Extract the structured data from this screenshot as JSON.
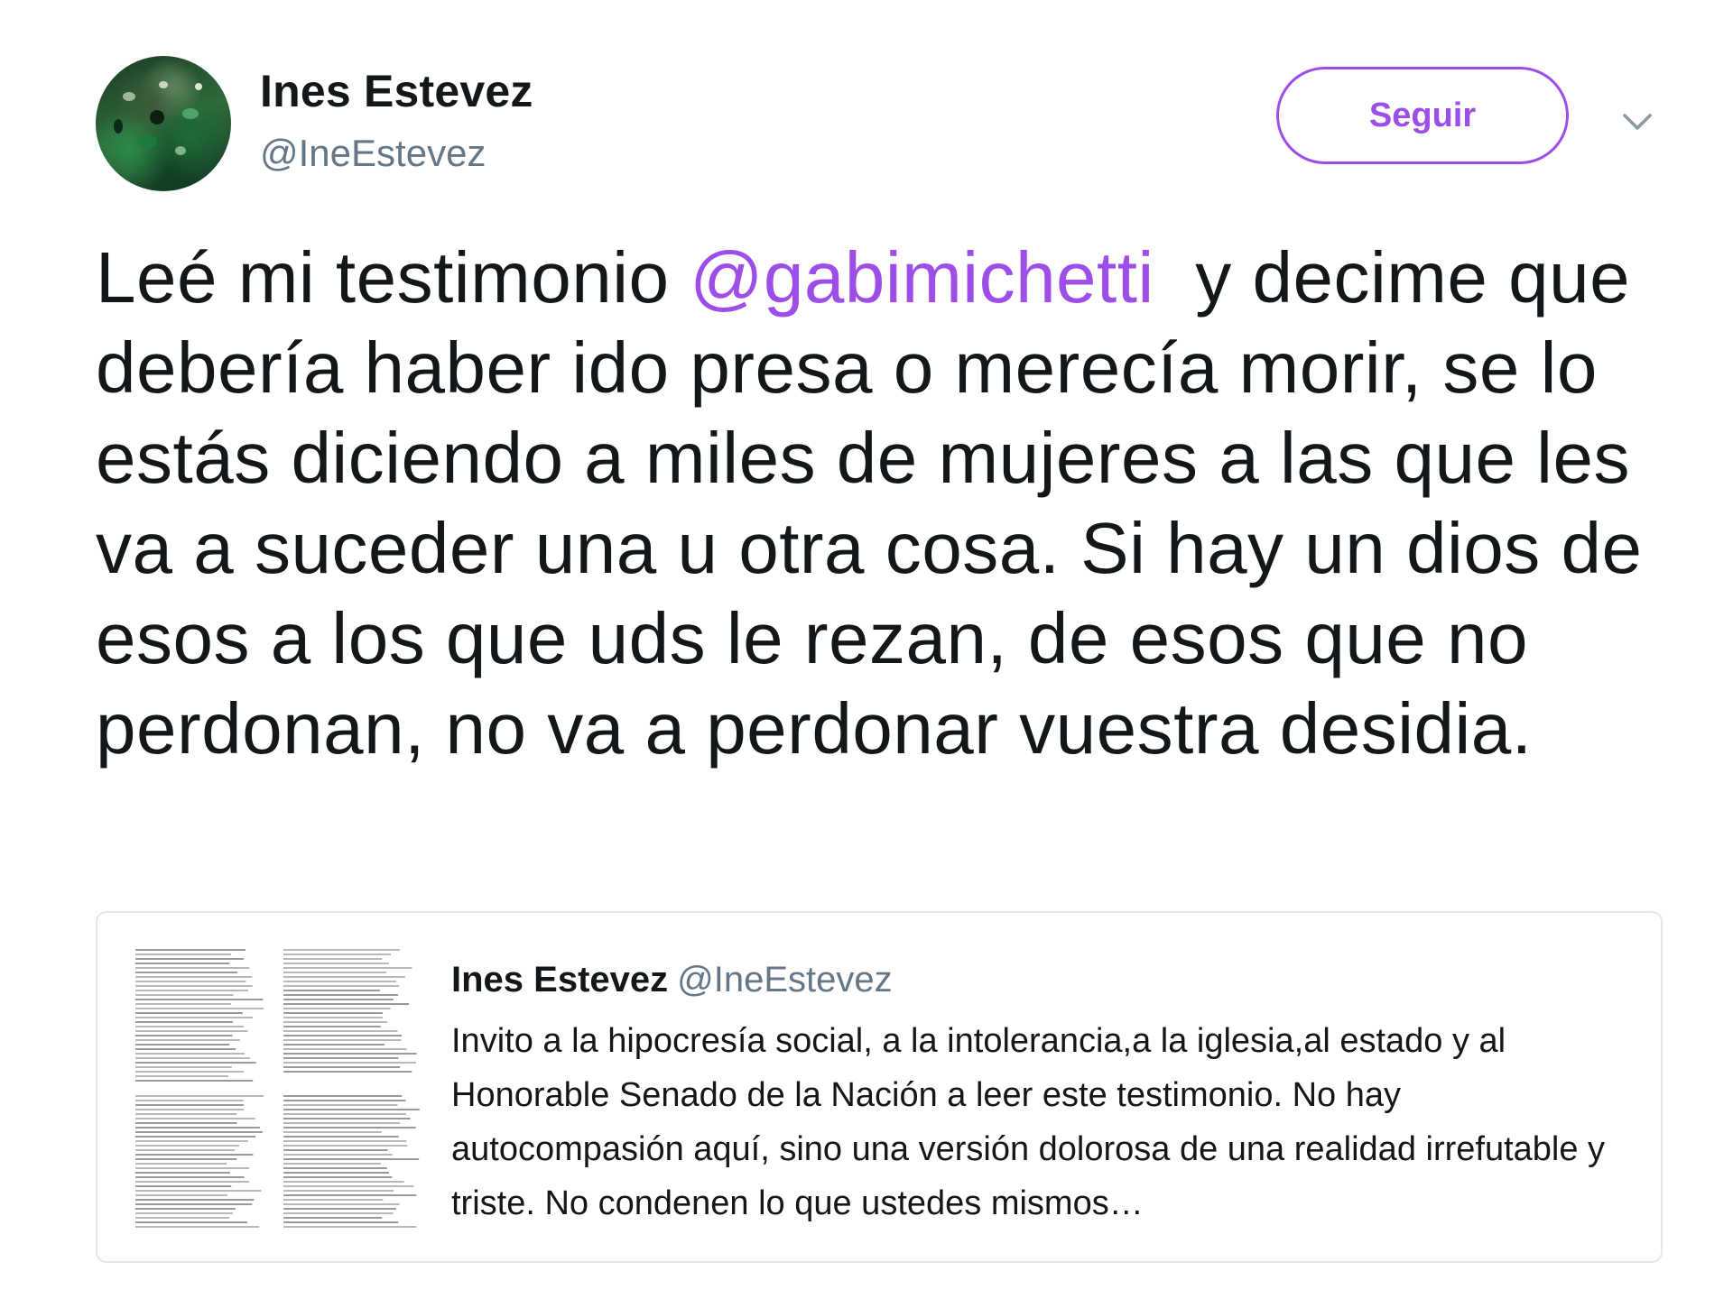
{
  "tweet": {
    "author": {
      "name": "Ines Estevez",
      "handle": "@IneEstevez"
    },
    "follow_label": "Seguir",
    "menu_icon": "chevron-down-icon",
    "text": {
      "before_mention": "Leé mi testimonio ",
      "mention": "@gabimichetti",
      "after_mention": "  y decime que debería haber ido presa o merecía morir, se lo estás diciendo a miles de mujeres a las que les va a suceder una u otra cosa. Si hay un dios de esos a los que uds le rezan, de esos que no perdonan, no va a perdonar vuestra desidia."
    },
    "quoted": {
      "name": "Ines Estevez",
      "handle": "@IneEstevez",
      "text": "Invito a la hipocresía social, a la intolerancia,a la iglesia,al estado y al Honorable Senado de la Nación a leer este testimonio. No hay autocompasión aquí, sino una  versión dolorosa de una realidad irrefutable y triste. No condenen lo que ustedes mismos…",
      "thumbnail": "document-page-image"
    }
  },
  "colors": {
    "accent": "#9d4ee8",
    "text": "#14171a",
    "secondary_text": "#657786",
    "border": "#e1e8ed"
  }
}
